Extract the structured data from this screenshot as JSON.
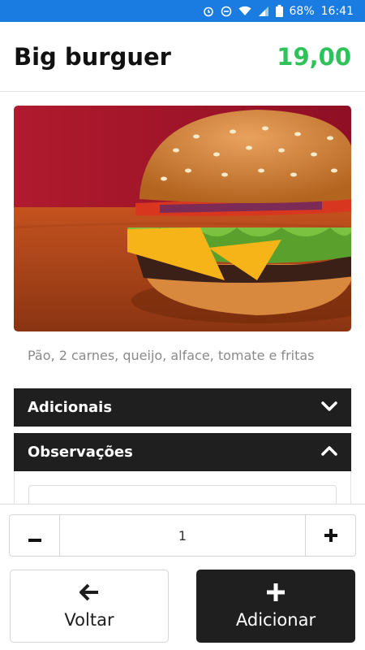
{
  "status_bar": {
    "icons": [
      "alarm-icon",
      "do-not-disturb-icon",
      "wifi-icon",
      "signal-icon",
      "battery-icon"
    ],
    "battery": "68%",
    "time": "16:41"
  },
  "product": {
    "title": "Big burguer",
    "price": "19,00",
    "description": "Pão, 2 carnes, queijo, alface, tomate e fritas",
    "image_alt": "burger-photo"
  },
  "accordion": {
    "adicionais": {
      "label": "Adicionais",
      "expanded": false
    },
    "observacoes": {
      "label": "Observações",
      "expanded": true,
      "input_value": ""
    }
  },
  "quantity": {
    "value": "1",
    "minus": "−",
    "plus": "+"
  },
  "actions": {
    "back_label": "Voltar",
    "add_label": "Adicionar"
  },
  "colors": {
    "status_bar": "#1a7be0",
    "price": "#2fc25a",
    "dark": "#1f1f1f"
  }
}
